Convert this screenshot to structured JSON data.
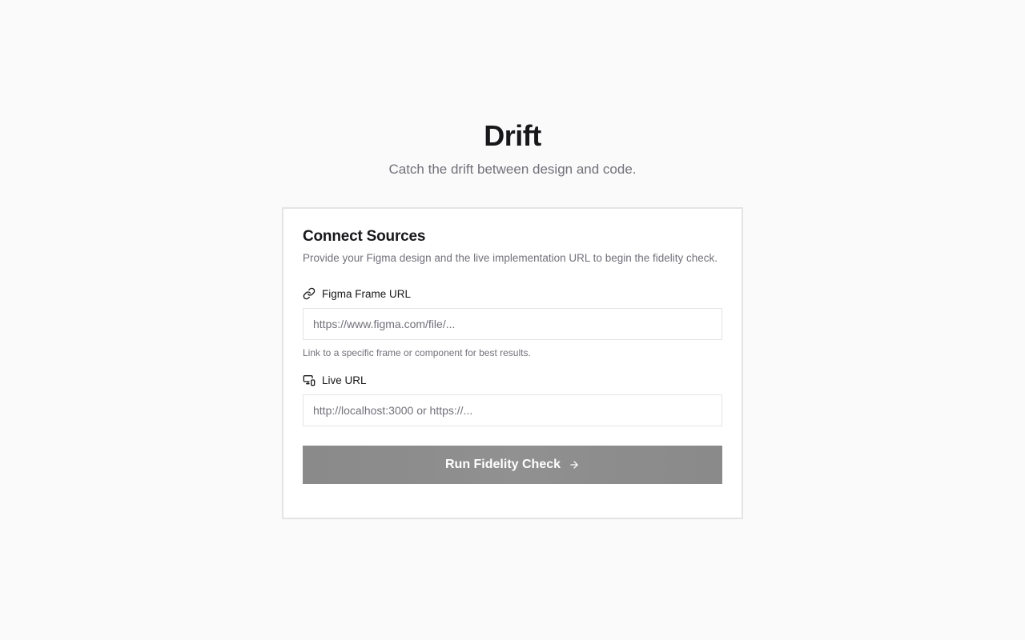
{
  "hero": {
    "title": "Drift",
    "subtitle": "Catch the drift between design and code."
  },
  "card": {
    "title": "Connect Sources",
    "description": "Provide your Figma design and the live implementation URL to begin the fidelity check.",
    "figma_field": {
      "icon": "link-icon",
      "label": "Figma Frame URL",
      "value": "",
      "placeholder": "https://www.figma.com/file/...",
      "hint": "Link to a specific frame or component for best results."
    },
    "live_field": {
      "icon": "devices-icon",
      "label": "Live URL",
      "value": "",
      "placeholder": "http://localhost:3000 or https://..."
    },
    "submit": {
      "label": "Run Fidelity Check",
      "icon": "arrow-right-icon"
    }
  },
  "colors": {
    "background": "#fafafa",
    "text": "#18181b",
    "muted": "#71717a",
    "border": "#e4e4e7",
    "button": "#8d8d8d"
  }
}
